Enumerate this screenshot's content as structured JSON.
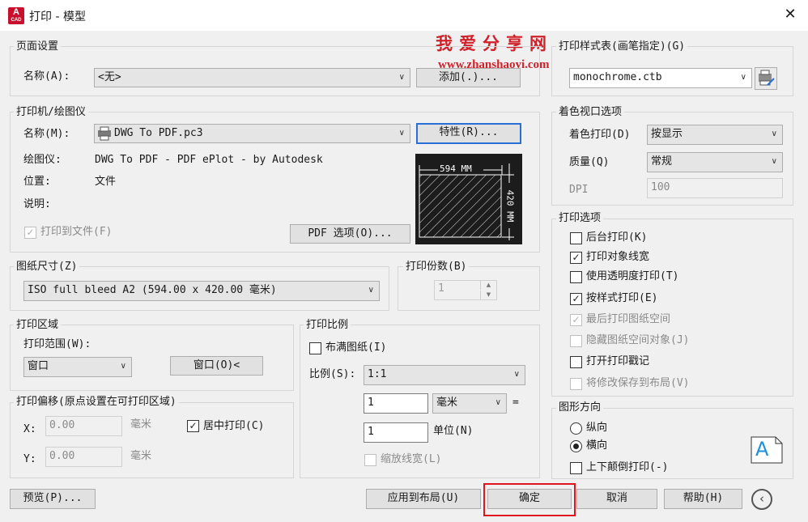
{
  "window": {
    "title": "打印 - 模型",
    "app_icon_letter": "A",
    "app_icon_sub": "CAD"
  },
  "watermark": {
    "title": "我爱分享网",
    "url": "www.zhanshaoyi.com"
  },
  "page_setup": {
    "group_label": "页面设置",
    "name_label": "名称(A):",
    "name_value": "<无>",
    "add_button": "添加(.)..."
  },
  "printer": {
    "group_label": "打印机/绘图仪",
    "name_label": "名称(M):",
    "name_value": "DWG To PDF.pc3",
    "properties_button": "特性(R)...",
    "plotter_label": "绘图仪:",
    "plotter_value": "DWG To PDF - PDF ePlot - by Autodesk",
    "location_label": "位置:",
    "location_value": "文件",
    "description_label": "说明:",
    "print_to_file": "打印到文件(F)",
    "pdf_options_button": "PDF 选项(O)...",
    "preview_width": "594 MM",
    "preview_height": "420 MM"
  },
  "paper_size": {
    "group_label": "图纸尺寸(Z)",
    "value": "ISO full bleed A2 (594.00 x 420.00 毫米)"
  },
  "copies": {
    "group_label": "打印份数(B)",
    "value": "1"
  },
  "plot_area": {
    "group_label": "打印区域",
    "range_label": "打印范围(W):",
    "range_value": "窗口",
    "window_button": "窗口(O)<"
  },
  "plot_offset": {
    "group_label": "打印偏移(原点设置在可打印区域)",
    "x_label": "X:",
    "x_value": "0.00",
    "x_unit": "毫米",
    "y_label": "Y:",
    "y_value": "0.00",
    "y_unit": "毫米",
    "center_plot": "居中打印(C)"
  },
  "plot_scale": {
    "group_label": "打印比例",
    "fit_to_paper": "布满图纸(I)",
    "scale_label": "比例(S):",
    "scale_value": "1:1",
    "value1": "1",
    "unit1": "毫米",
    "equals": "=",
    "value2": "1",
    "unit2": "单位(N)",
    "scale_lineweights": "缩放线宽(L)"
  },
  "plot_style_table": {
    "group_label": "打印样式表(画笔指定)(G)",
    "value": "monochrome.ctb"
  },
  "shaded_viewport": {
    "group_label": "着色视口选项",
    "shade_plot_label": "着色打印(D)",
    "shade_plot_value": "按显示",
    "quality_label": "质量(Q)",
    "quality_value": "常规",
    "dpi_label": "DPI",
    "dpi_value": "100"
  },
  "plot_options": {
    "group_label": "打印选项",
    "items": [
      {
        "label": "后台打印(K)",
        "checked": false,
        "disabled": false
      },
      {
        "label": "打印对象线宽",
        "checked": true,
        "disabled": false
      },
      {
        "label": "使用透明度打印(T)",
        "checked": false,
        "disabled": false
      },
      {
        "label": "按样式打印(E)",
        "checked": true,
        "disabled": false
      },
      {
        "label": "最后打印图纸空间",
        "checked": true,
        "disabled": true
      },
      {
        "label": "隐藏图纸空间对象(J)",
        "checked": false,
        "disabled": true
      },
      {
        "label": "打开打印戳记",
        "checked": false,
        "disabled": false
      },
      {
        "label": "将修改保存到布局(V)",
        "checked": false,
        "disabled": true
      }
    ]
  },
  "drawing_orientation": {
    "group_label": "图形方向",
    "portrait": "纵向",
    "landscape": "横向",
    "selected": "landscape",
    "upside_down": "上下颠倒打印(-)",
    "icon_letter": "A"
  },
  "footer": {
    "preview_button": "预览(P)...",
    "apply_layout_button": "应用到布局(U)",
    "ok_button": "确定",
    "cancel_button": "取消",
    "help_button": "帮助(H)",
    "collapse_icon": "‹"
  }
}
